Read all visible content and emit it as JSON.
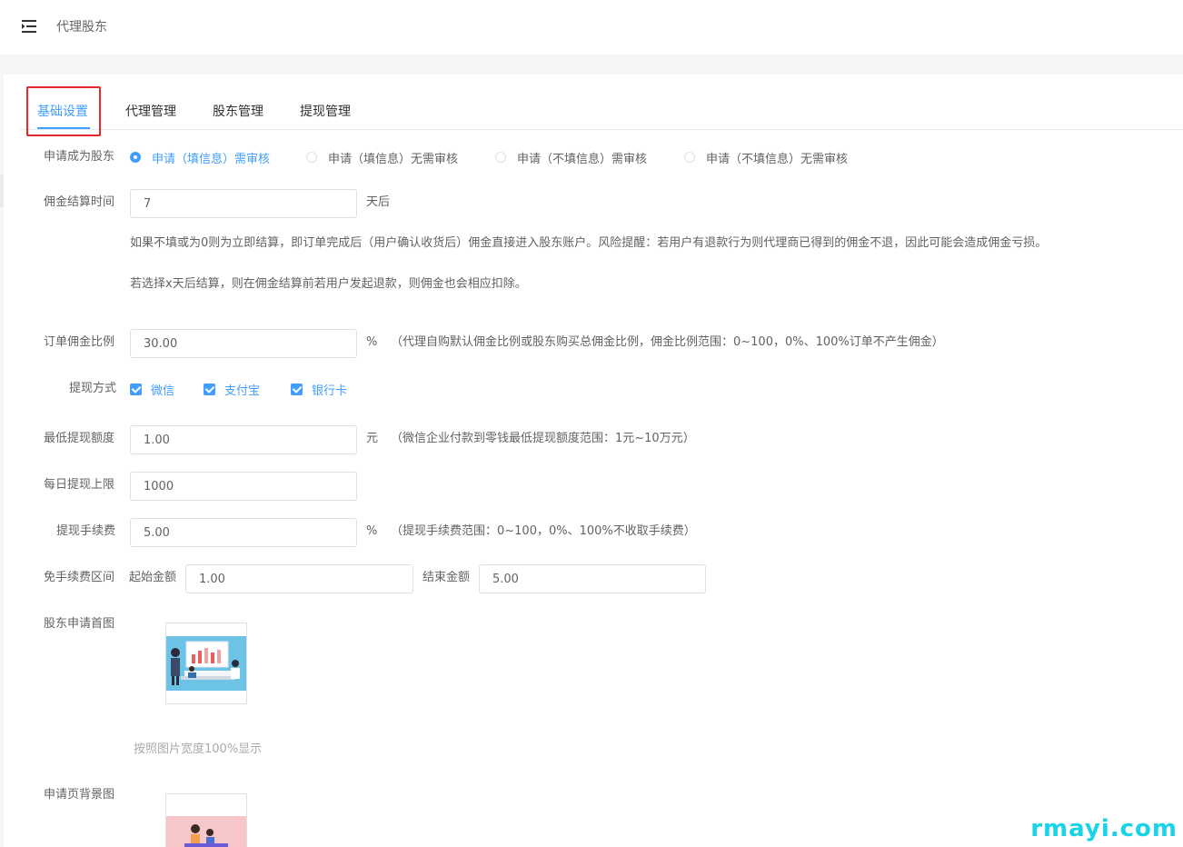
{
  "header": {
    "title": "代理股东"
  },
  "tabs": [
    {
      "label": "基础设置",
      "active": true
    },
    {
      "label": "代理管理",
      "active": false
    },
    {
      "label": "股东管理",
      "active": false
    },
    {
      "label": "提现管理",
      "active": false
    }
  ],
  "form": {
    "apply": {
      "label": "申请成为股东",
      "options": [
        {
          "label": "申请（填信息）需审核",
          "checked": true
        },
        {
          "label": "申请（填信息）无需审核",
          "checked": false
        },
        {
          "label": "申请（不填信息）需审核",
          "checked": false
        },
        {
          "label": "申请（不填信息）无需审核",
          "checked": false
        }
      ]
    },
    "settle": {
      "label": "佣金结算时间",
      "value": "7",
      "unit": "天后",
      "note1": "如果不填或为0则为立即结算，即订单完成后（用户确认收货后）佣金直接进入股东账户。风险提醒：若用户有退款行为则代理商已得到的佣金不退，因此可能会造成佣金亏损。",
      "note2": "若选择x天后结算，则在佣金结算前若用户发起退款，则佣金也会相应扣除。"
    },
    "ratio": {
      "label": "订单佣金比例",
      "value": "30.00",
      "unit": "%",
      "hint": "（代理自购默认佣金比例或股东购买总佣金比例，佣金比例范围：0~100，0%、100%订单不产生佣金）"
    },
    "withdraw_method": {
      "label": "提现方式",
      "options": [
        {
          "label": "微信",
          "checked": true
        },
        {
          "label": "支付宝",
          "checked": true
        },
        {
          "label": "银行卡",
          "checked": true
        }
      ]
    },
    "min_withdraw": {
      "label": "最低提现额度",
      "value": "1.00",
      "unit": "元",
      "hint": "（微信企业付款到零钱最低提现额度范围：1元~10万元）"
    },
    "daily_limit": {
      "label": "每日提现上限",
      "value": "1000"
    },
    "fee": {
      "label": "提现手续费",
      "value": "5.00",
      "unit": "%",
      "hint": "（提现手续费范围：0~100，0%、100%不收取手续费）"
    },
    "free_range": {
      "label": "免手续费区间",
      "start_label": "起始金额",
      "start_value": "1.00",
      "end_label": "结束金额",
      "end_value": "5.00"
    },
    "home_image": {
      "label": "股东申请首图",
      "note": "按照图片宽度100%显示"
    },
    "bg_image": {
      "label": "申请页背景图"
    }
  },
  "watermark": "rmayi.com",
  "colors": {
    "primary": "#409eff",
    "highlight": "#e8272b",
    "watermark": "#19d3e8"
  }
}
